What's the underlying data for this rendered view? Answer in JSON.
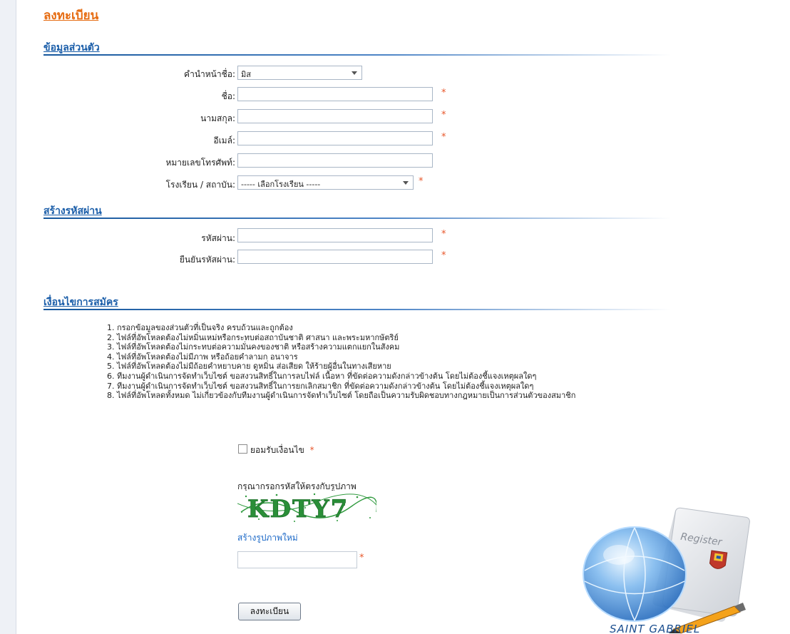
{
  "page": {
    "title": "ลงทะเบียน"
  },
  "personal": {
    "header": "ข้อมูลส่วนตัว",
    "prefix_label": "คำนำหน้าชื่อ:",
    "prefix_value": "มิส",
    "firstname_label": "ชื่อ:",
    "lastname_label": "นามสกุล:",
    "email_label": "อีเมล์:",
    "phone_label": "หมายเลขโทรศัพท์:",
    "school_label": "โรงเรียน / สถาบัน:",
    "school_value": "----- เลือกโรงเรียน -----"
  },
  "password": {
    "header": "สร้างรหัสผ่าน",
    "password_label": "รหัสผ่าน:",
    "confirm_label": "ยืนยันรหัสผ่าน:"
  },
  "conditions": {
    "header": "เงื่อนไขการสมัคร",
    "items": [
      "1. กรอกข้อมูลของส่วนตัวที่เป็นจริง ครบถ้วนและถูกต้อง",
      "2. ไฟล์ที่อัพโหลดต้องไม่หมิ่นเหม่หรือกระทบต่อสถาบันชาติ ศาสนา และพระมหากษัตริย์",
      "3. ไฟล์ที่อัพโหลดต้องไม่กระทบต่อความมั่นคงของชาติ หรือสร้างความแตกแยกในสังคม",
      "4. ไฟล์ที่อัพโหลดต้องไม่มีภาพ หรือถ้อยคำลามก อนาจาร",
      "5. ไฟล์ที่อัพโหลดต้องไม่มีถ้อยคำหยาบคาย ดูหมิ่น ส่อเสียด ให้ร้ายผู้อื่นในทางเสียหาย",
      "6. ทีมงานผู้ดำเนินการจัดทำเว็บไซต์ ขอสงวนสิทธิ์ในการลบไฟล์ เนื้อหา ที่ขัดต่อความดังกล่าวข้างต้น โดยไม่ต้องชี้แจงเหตุผลใดๆ",
      "7. ทีมงานผู้ดำเนินการจัดทำเว็บไซต์ ขอสงวนสิทธิ์ในการยกเลิกสมาชิก ที่ขัดต่อความดังกล่าวข้างต้น โดยไม่ต้องชี้แจงเหตุผลใดๆ",
      "8. ไฟล์ที่อัพโหลดทั้งหมด ไม่เกี่ยวข้องกับทีมงานผู้ดำเนินการจัดทำเว็บไซต์ โดยถือเป็นความรับผิดชอบทางกฎหมายเป็นการส่วนตัวของสมาชิก"
    ],
    "agree_label": "ยอมรับเงื่อนไข"
  },
  "captcha": {
    "instruction": "กรุณากรอกรหัสให้ตรงกับรูปภาพ",
    "code": "KDTY7",
    "refresh_link": "สร้างรูปภาพใหม่"
  },
  "required_mark": "*",
  "submit_label": "ลงทะเบียน",
  "logo": {
    "brand": "SAINT GABRIEL",
    "paper_label": "Register"
  },
  "colors": {
    "accent_orange": "#e66c12",
    "section_blue": "#1b5ea9",
    "required_red": "#e8562a",
    "link_blue": "#1b68c7"
  }
}
